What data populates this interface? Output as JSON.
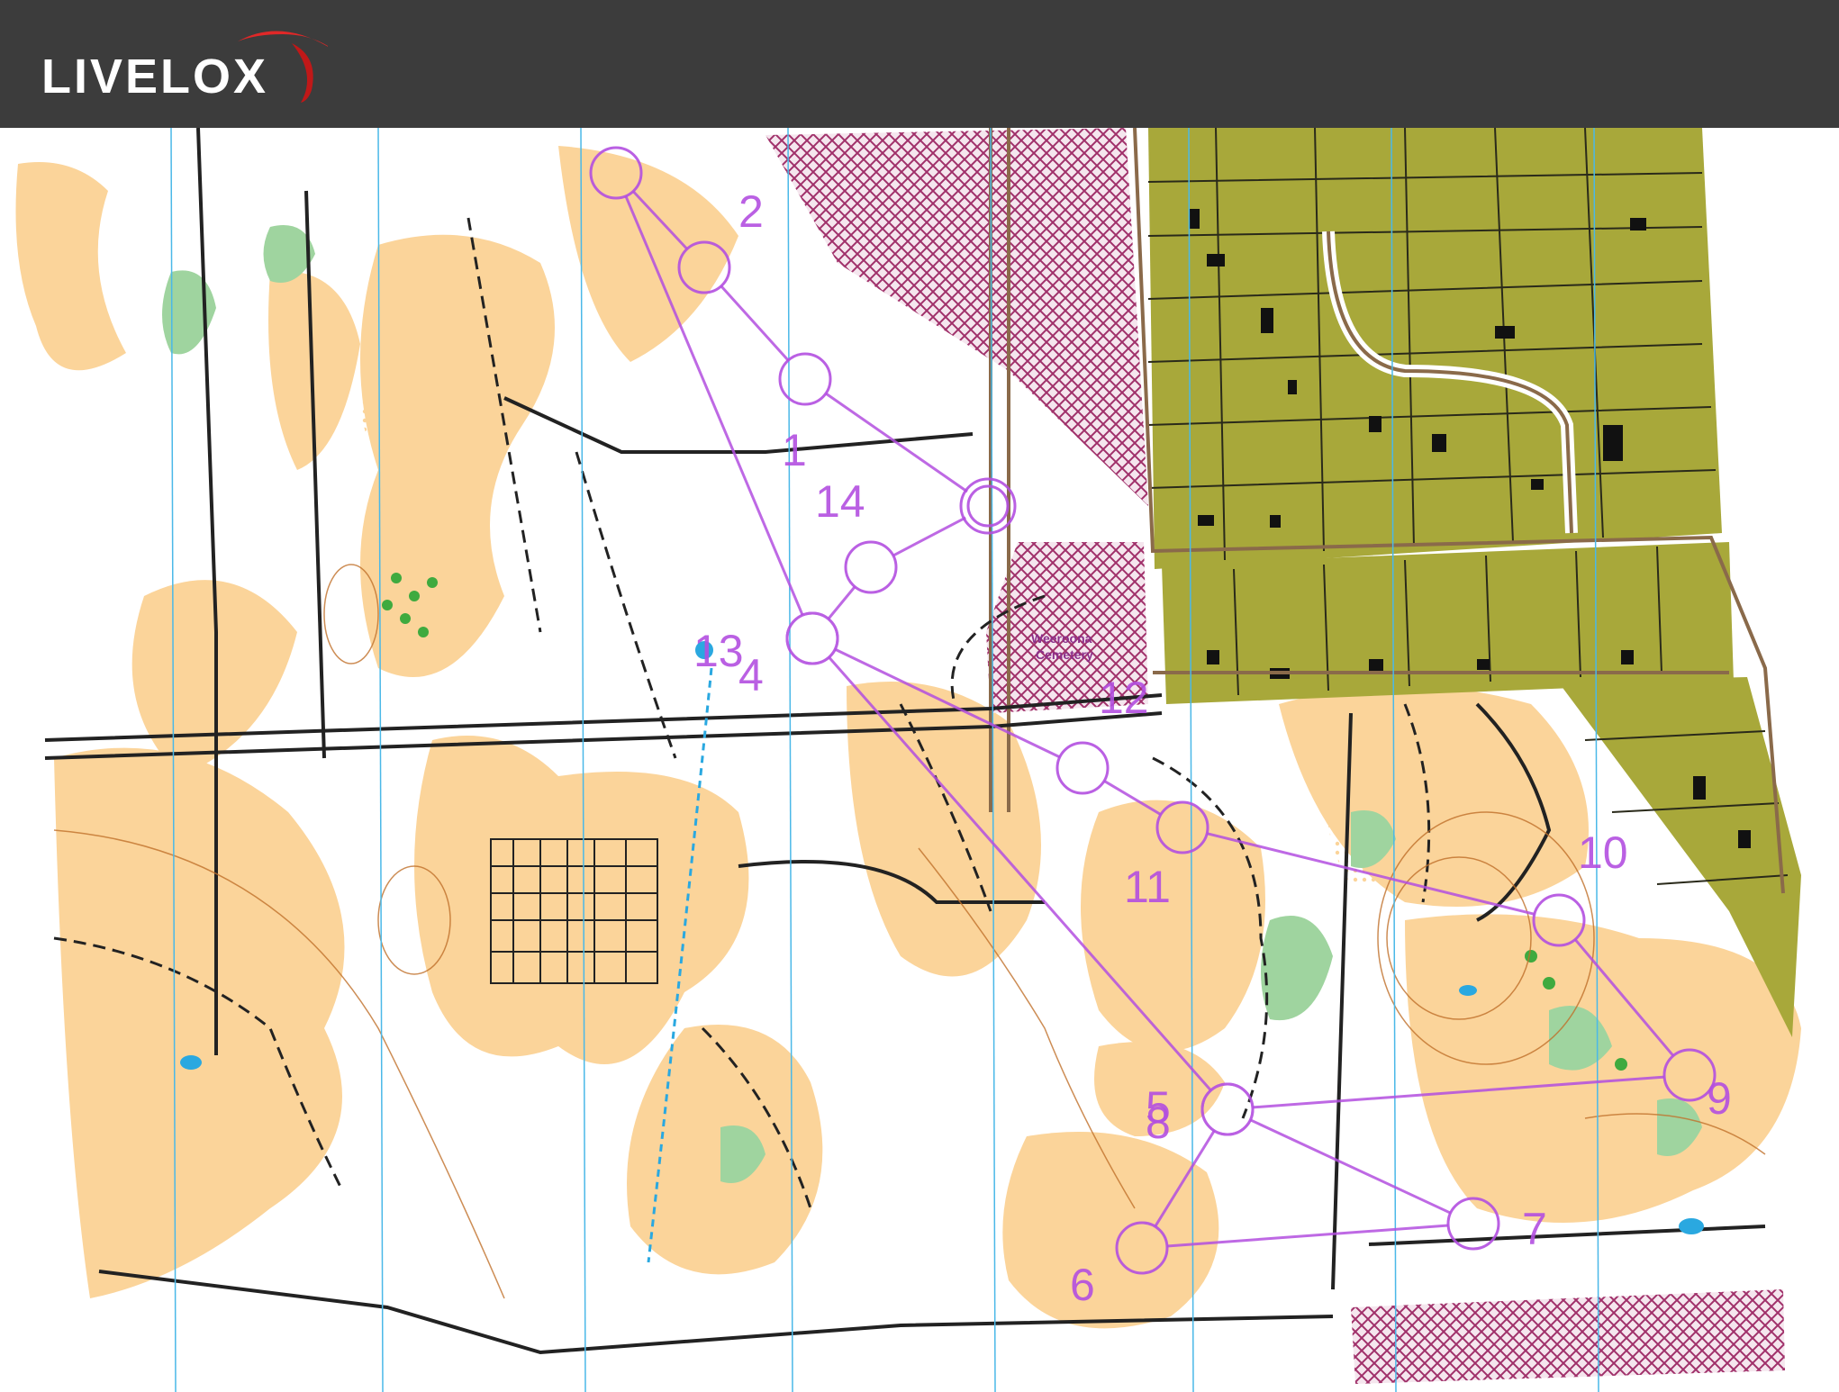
{
  "app": {
    "brand": "LIVELOX"
  },
  "map": {
    "place_label": [
      "Weeroona",
      "Cemetery"
    ],
    "course_color": "#b34fe0",
    "colors": {
      "open_land": "#fbd49a",
      "vegetation_green": "#7fc47f",
      "urban_olive": "#a8a83a",
      "out_of_bounds": "#a0306a",
      "track": "#222222",
      "contour": "#c0702a",
      "water": "#2aa8e0",
      "magnetic_north_lines": "#4ab8e8"
    },
    "icons": [
      "livelox-logo-swoosh"
    ],
    "controls": [
      {
        "label": "1"
      },
      {
        "label": "2"
      },
      {
        "label": "4"
      },
      {
        "label": "5"
      },
      {
        "label": "6"
      },
      {
        "label": "7"
      },
      {
        "label": "8"
      },
      {
        "label": "9"
      },
      {
        "label": "10"
      },
      {
        "label": "11"
      },
      {
        "label": "12"
      },
      {
        "label": "13"
      },
      {
        "label": "14"
      }
    ]
  }
}
